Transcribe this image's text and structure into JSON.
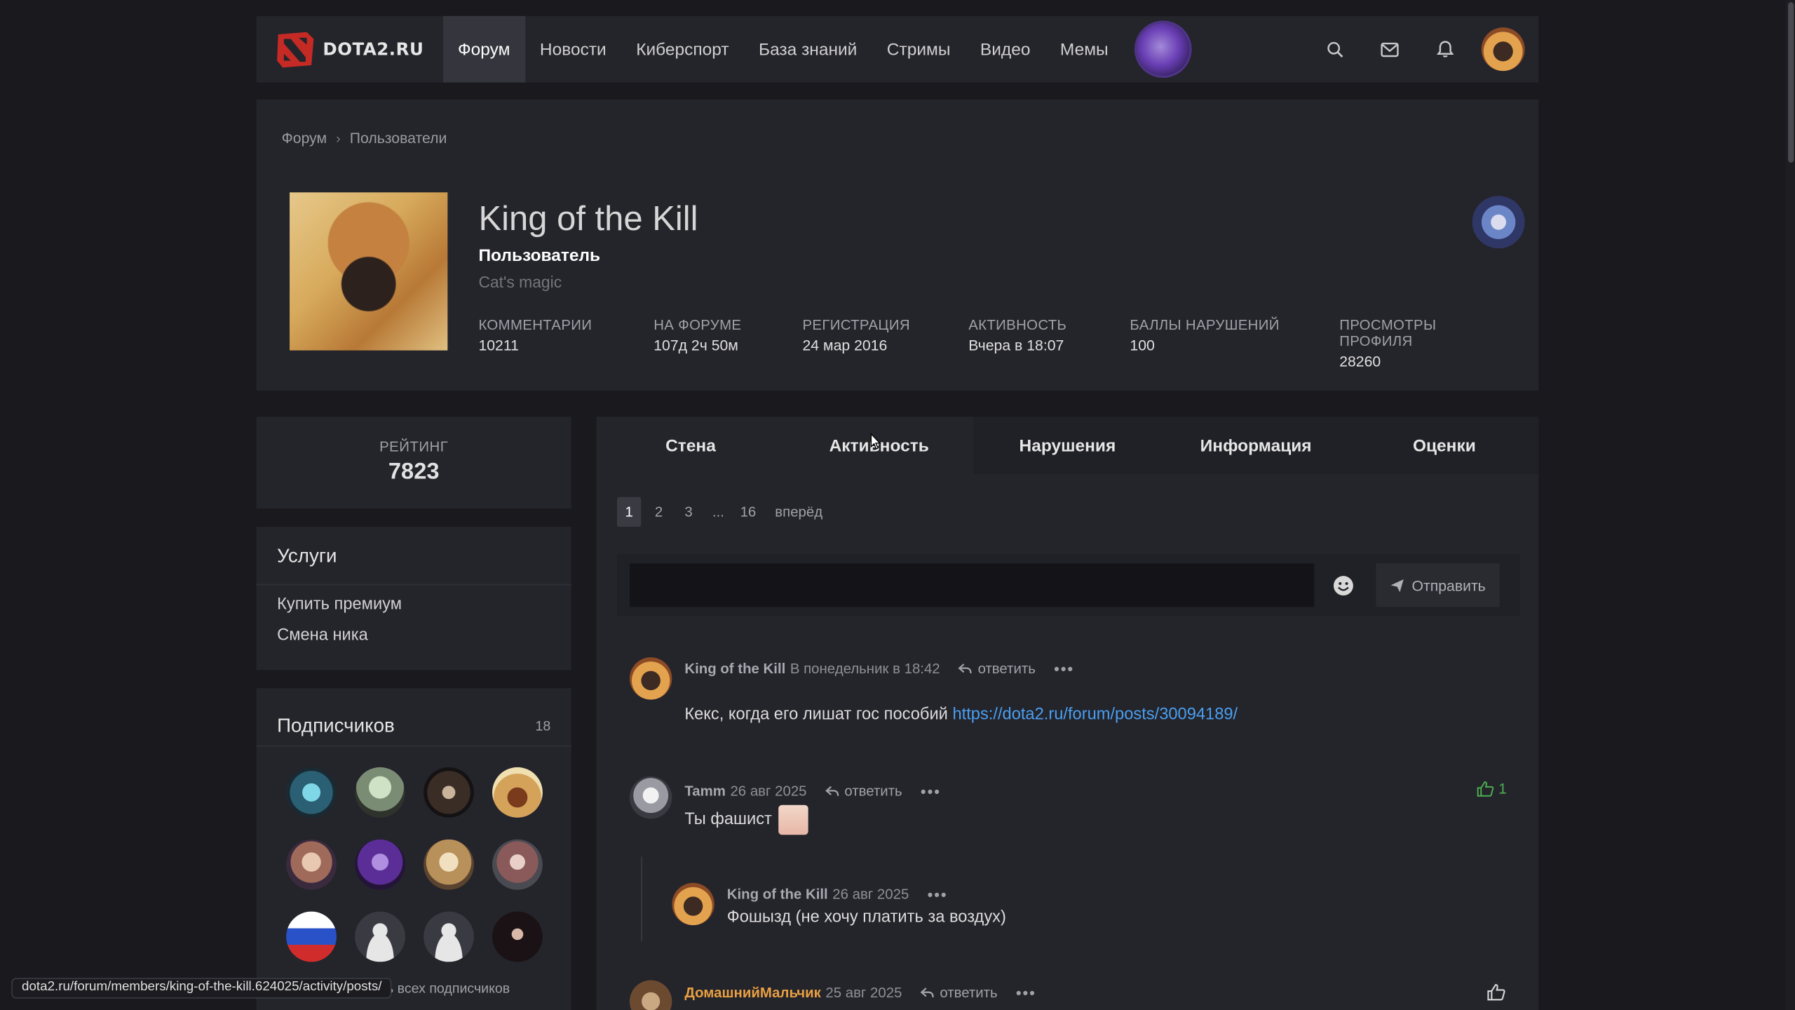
{
  "site": {
    "logo_text": "DOTA2.RU"
  },
  "nav": {
    "items": [
      "Форум",
      "Новости",
      "Киберспорт",
      "База знаний",
      "Стримы",
      "Видео",
      "Мемы"
    ],
    "active_index": 0
  },
  "breadcrumb": [
    "Форум",
    "Пользователи"
  ],
  "profile": {
    "name": "King of the Kill",
    "role": "Пользователь",
    "status": "Cat's magic",
    "stats": [
      {
        "label": "Комментарии",
        "value": "10211"
      },
      {
        "label": "На форуме",
        "value": "107д 2ч 50м"
      },
      {
        "label": "Регистрация",
        "value": "24 мар 2016"
      },
      {
        "label": "Активность",
        "value": "Вчера в 18:07"
      },
      {
        "label": "Баллы нарушений",
        "value": "100"
      },
      {
        "label": "Просмотры профиля",
        "value": "28260"
      }
    ]
  },
  "rating": {
    "label": "РЕЙТИНГ",
    "value": "7823"
  },
  "services": {
    "title": "Услуги",
    "links": [
      "Купить премиум",
      "Смена ника"
    ]
  },
  "subscribers": {
    "title": "Подписчиков",
    "count": "18",
    "more": "Посмотреть всех подписчиков"
  },
  "tabs": [
    "Стена",
    "Активность",
    "Нарушения",
    "Информация",
    "Оценки"
  ],
  "pager": {
    "pages": [
      "1",
      "2",
      "3",
      "...",
      "16"
    ],
    "next": "вперёд",
    "current": "1"
  },
  "composer": {
    "send_label": "Отправить"
  },
  "posts": [
    {
      "author": "King of the Kill",
      "date": "В понедельник в 18:42",
      "reply": "ответить",
      "text": "Кекс, когда его лишат гос пособий ",
      "link": "https://dota2.ru/forum/posts/30094189/"
    },
    {
      "author": "Tamm",
      "date": "26 авг 2025",
      "reply": "ответить",
      "text": "Ты фашист",
      "likes": "1"
    },
    {
      "author": "King of the Kill",
      "date": "26 авг 2025",
      "text": "Фошызд (не хочу платить за воздух)"
    },
    {
      "author": "ДомашнийМальчик",
      "date": "25 авг 2025",
      "reply": "ответить"
    }
  ],
  "status_url": "dota2.ru/forum/members/king-of-the-kill.624025/activity/posts/",
  "colors": {
    "background": "#19191e",
    "panel": "#24242b",
    "link": "#4a9ff0",
    "accent_orange": "#e8a042",
    "like_green": "#4caf50"
  }
}
